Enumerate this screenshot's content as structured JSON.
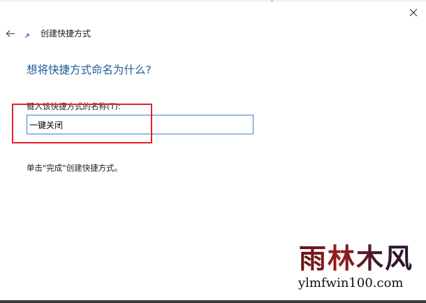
{
  "window": {
    "title": "创建快捷方式"
  },
  "page": {
    "heading": "想将快捷方式命名为什么?",
    "field_label": "键入该快捷方式的名称(T):",
    "name_value": "一键关闭",
    "instruction": "单击\"完成\"创建快捷方式。"
  },
  "watermark": {
    "chinese": "雨林木风",
    "url": "ylmfwin100.com"
  },
  "icons": {
    "close": "close-icon",
    "back": "back-arrow-icon",
    "app": "shortcut-icon"
  },
  "colors": {
    "heading": "#1e5b98",
    "input_border": "#3f7fc2",
    "highlight": "#e2222a"
  }
}
